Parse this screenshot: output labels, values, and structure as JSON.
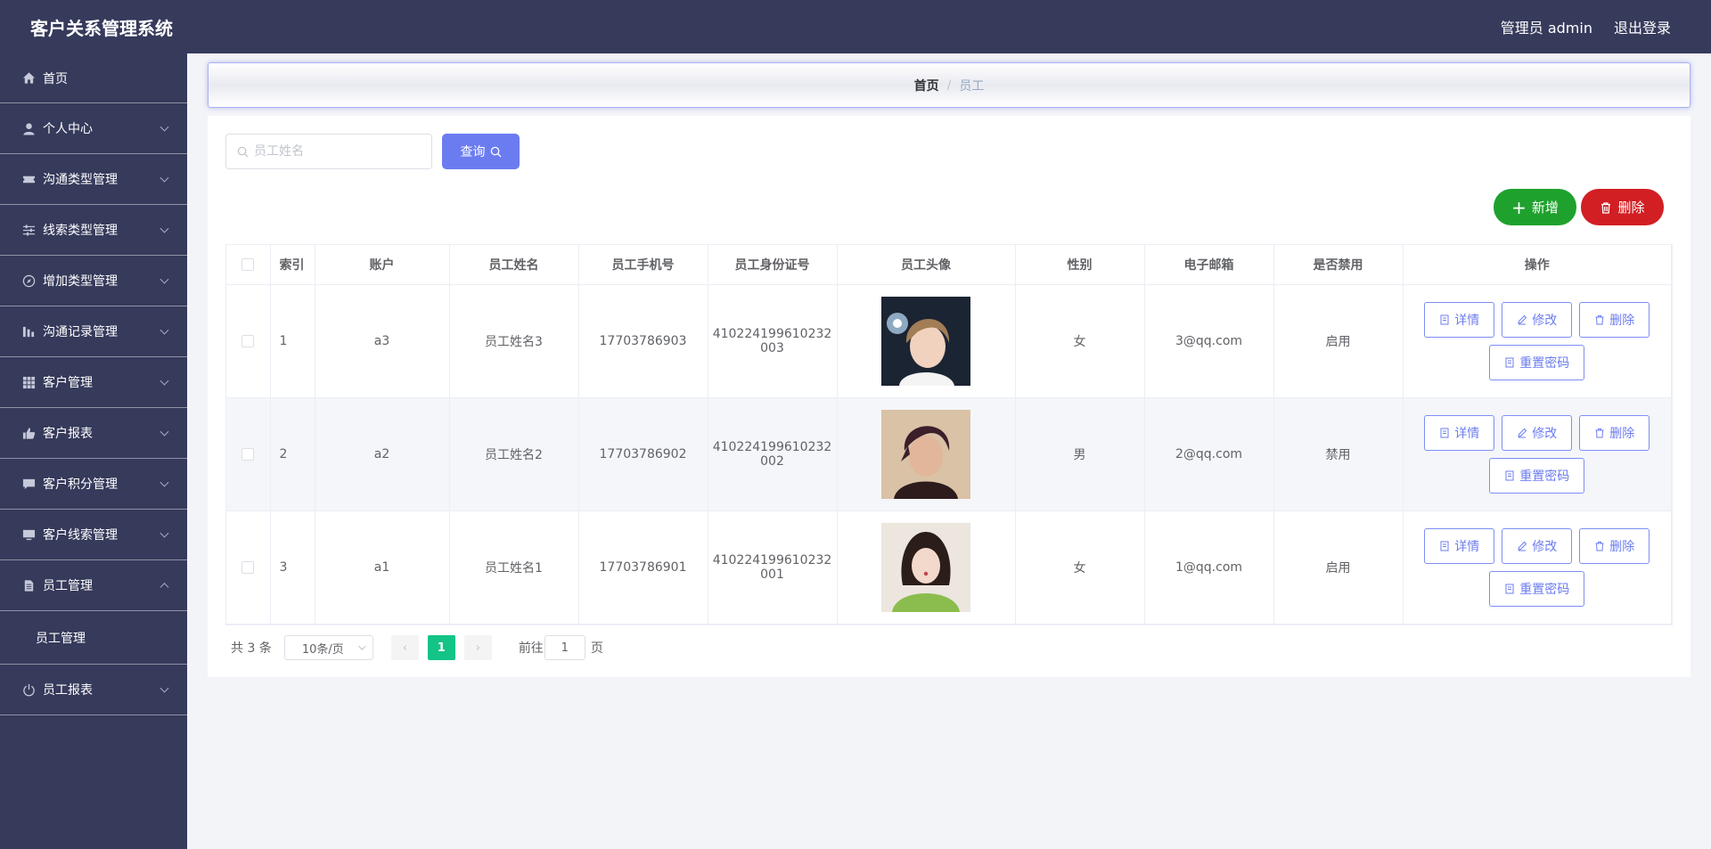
{
  "header": {
    "app_title": "客户关系管理系统",
    "user_label": "管理员 admin",
    "logout_label": "退出登录"
  },
  "sidebar": {
    "items": [
      {
        "label": "首页",
        "icon": "home-icon"
      },
      {
        "label": "个人中心",
        "icon": "user-icon"
      },
      {
        "label": "沟通类型管理",
        "icon": "ticket-icon"
      },
      {
        "label": "线索类型管理",
        "icon": "sliders-icon"
      },
      {
        "label": "增加类型管理",
        "icon": "compass-icon"
      },
      {
        "label": "沟通记录管理",
        "icon": "bar-chart-icon"
      },
      {
        "label": "客户管理",
        "icon": "grid-icon"
      },
      {
        "label": "客户报表",
        "icon": "thumb-up-icon"
      },
      {
        "label": "客户积分管理",
        "icon": "message-icon"
      },
      {
        "label": "客户线索管理",
        "icon": "monitor-icon"
      },
      {
        "label": "员工管理",
        "icon": "document-icon",
        "expanded": true,
        "children": [
          "员工管理"
        ]
      },
      {
        "label": "员工报表",
        "icon": "power-icon"
      }
    ]
  },
  "breadcrumb": {
    "home": "首页",
    "separator": "/",
    "current": "员工"
  },
  "search": {
    "placeholder": "员工姓名",
    "value": "",
    "button_label": "查询"
  },
  "toolbar": {
    "add_label": "新增",
    "delete_label": "删除"
  },
  "table": {
    "columns": [
      "索引",
      "账户",
      "员工姓名",
      "员工手机号",
      "员工身份证号",
      "员工头像",
      "性别",
      "电子邮箱",
      "是否禁用",
      "操作"
    ],
    "rows": [
      {
        "index": "1",
        "account": "a3",
        "name": "员工姓名3",
        "phone": "17703786903",
        "id_line1": "410224199610232",
        "id_line2": "003",
        "gender": "女",
        "email": "3@qq.com",
        "status": "启用"
      },
      {
        "index": "2",
        "account": "a2",
        "name": "员工姓名2",
        "phone": "17703786902",
        "id_line1": "410224199610232",
        "id_line2": "002",
        "gender": "男",
        "email": "2@qq.com",
        "status": "禁用"
      },
      {
        "index": "3",
        "account": "a1",
        "name": "员工姓名1",
        "phone": "17703786901",
        "id_line1": "410224199610232",
        "id_line2": "001",
        "gender": "女",
        "email": "1@qq.com",
        "status": "启用"
      }
    ],
    "actions": {
      "detail": "详情",
      "edit": "修改",
      "delete": "删除",
      "reset_password": "重置密码"
    }
  },
  "pagination": {
    "total_text": "共 3 条",
    "page_size": "10条/页",
    "current_page": "1",
    "goto_label": "前往",
    "goto_value": "1",
    "page_suffix": "页"
  },
  "colors": {
    "sidebar_bg": "#363a5b",
    "accent": "#6b7cf0",
    "add_button": "#1fa12e",
    "delete_button": "#d11f24",
    "page_active": "#13c486"
  }
}
